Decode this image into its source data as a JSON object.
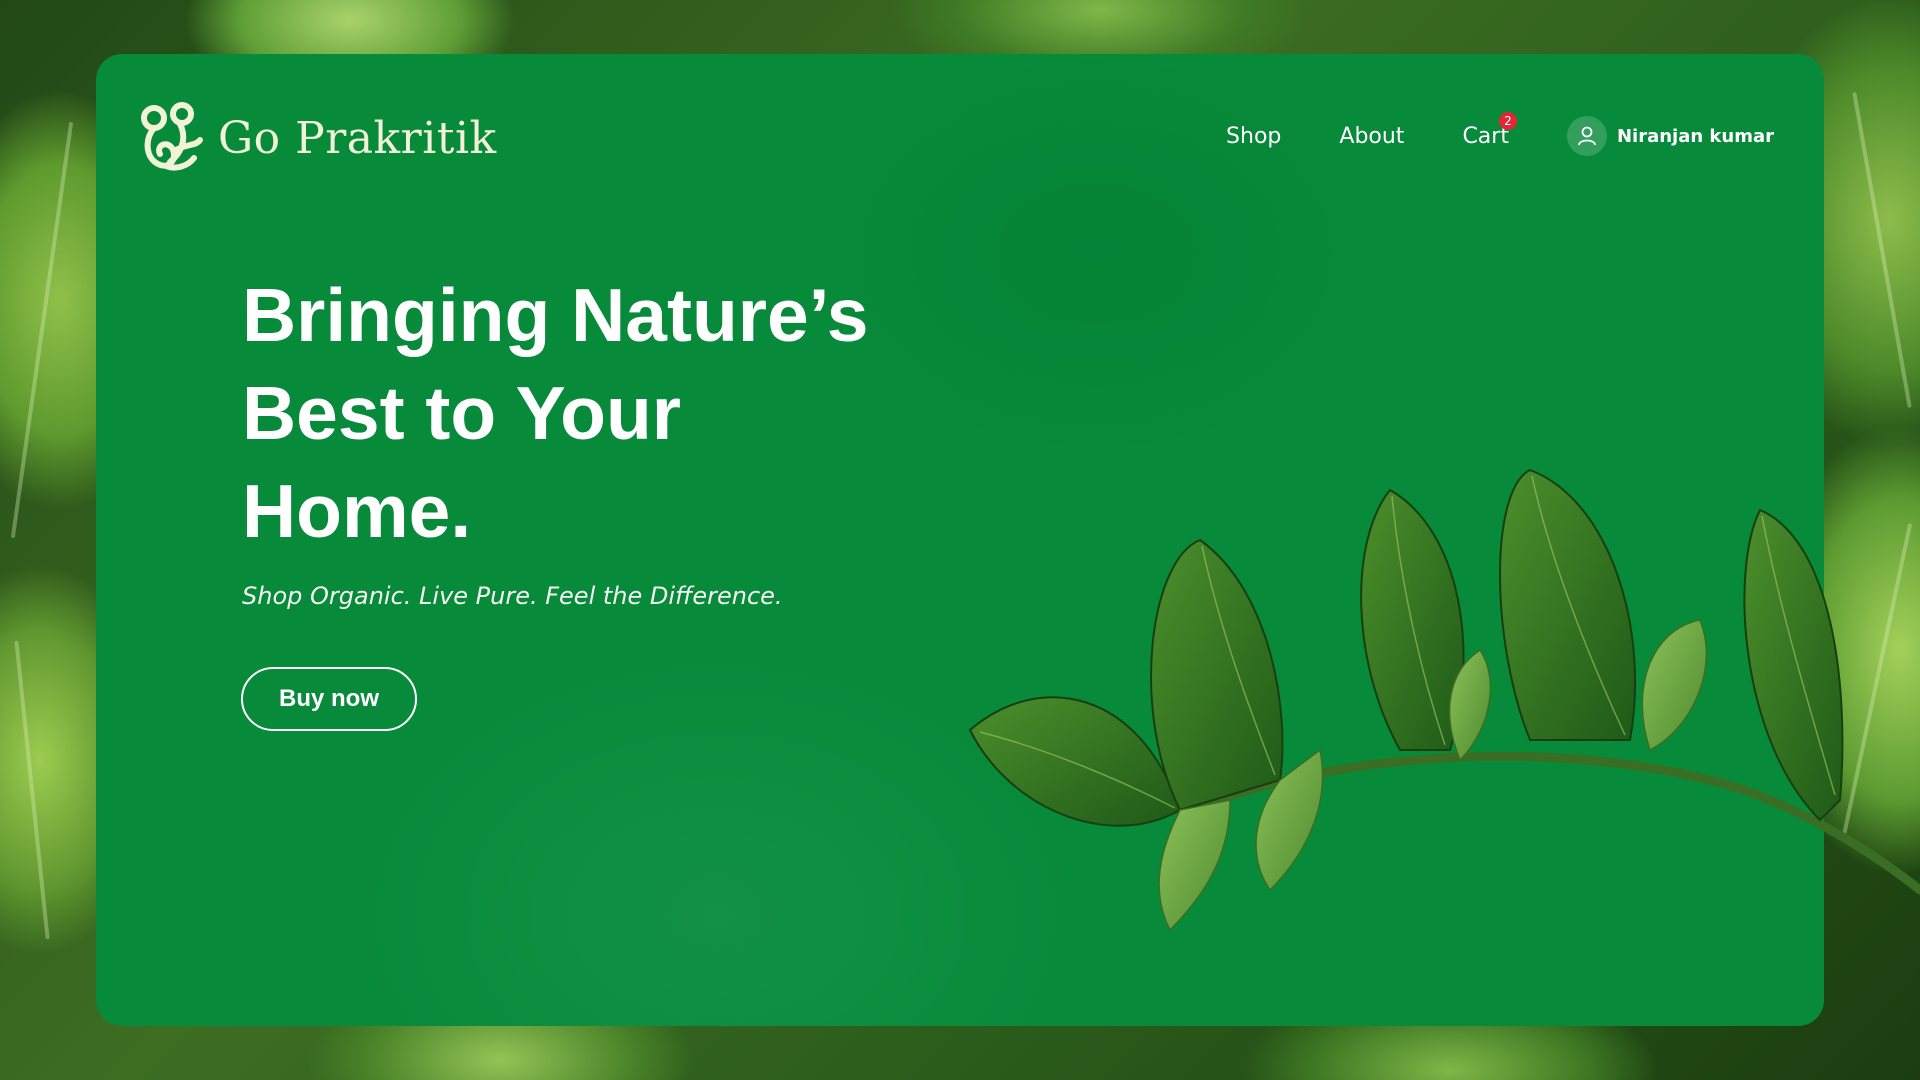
{
  "brand": {
    "name": "Go Prakritik",
    "logo_icon": "leaf-swirl-logo"
  },
  "nav": {
    "shop": "Shop",
    "about": "About",
    "cart": "Cart",
    "cart_count": "2",
    "user_name": "Niranjan kumar",
    "user_icon": "user-icon"
  },
  "hero": {
    "title_line1": "Bringing Nature’s",
    "title_line2": "Best to Your",
    "title_line3": "Home.",
    "tagline": "Shop Organic. Live Pure. Feel the Difference.",
    "cta": "Buy now"
  },
  "colors": {
    "card_green": "#078a3a",
    "logo_cream": "#f1f3d6",
    "badge_red": "#e32636",
    "text_white": "#ffffff"
  }
}
